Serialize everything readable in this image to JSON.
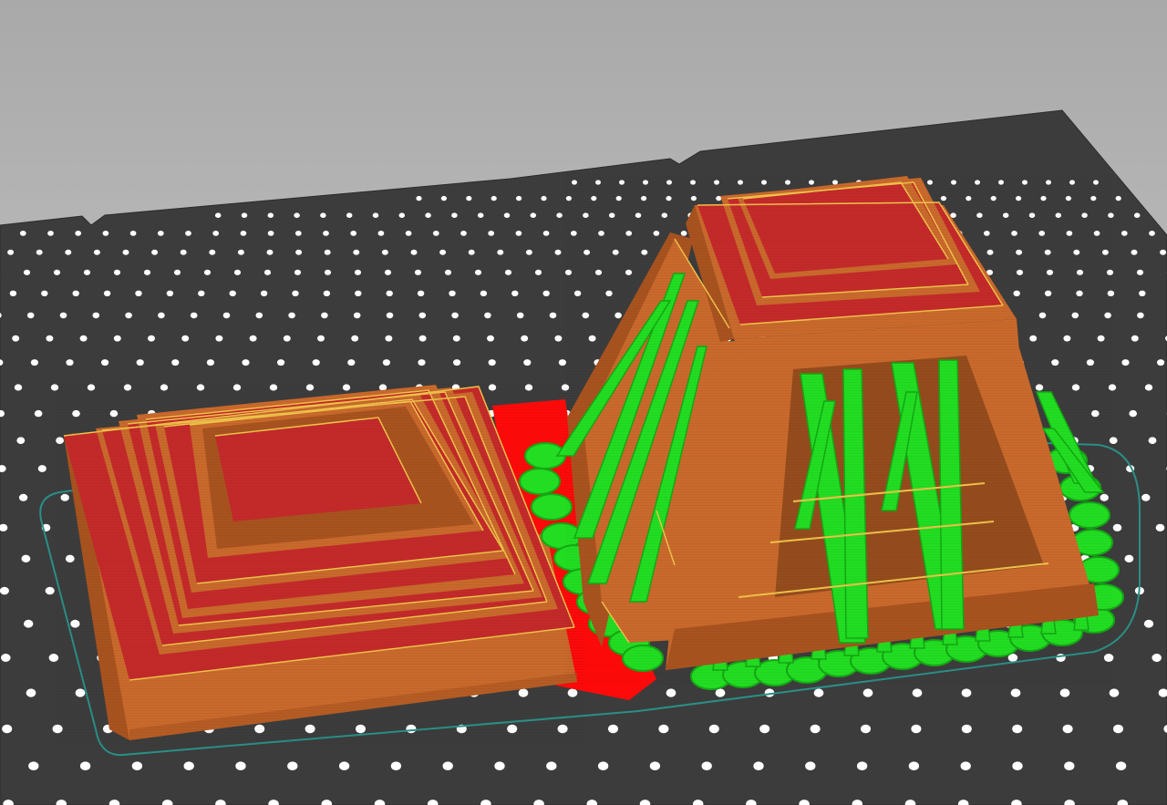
{
  "viewport": {
    "name": "slicer-3d-preview",
    "background_top": "#a9a9a9",
    "background_bottom": "#d2d2d2"
  },
  "bed": {
    "surface_color": "#3c3c3c",
    "edge_color": "#2b2b2b",
    "dot_color": "#ffffff"
  },
  "feature_colors": {
    "perimeter": "#c9692c",
    "perimeter_shade": "#a8531f",
    "top_solid_infill": "#c42a2a",
    "edge_highlight": "#f0c24a",
    "support_material": "#22dd22",
    "support_shade": "#14a814",
    "bridge_or_first_layer": "#ff0a0a",
    "skirt": "#2a8f86"
  },
  "objects": [
    {
      "name": "stepped-pyramid-base"
    },
    {
      "name": "temple-with-supports"
    }
  ]
}
